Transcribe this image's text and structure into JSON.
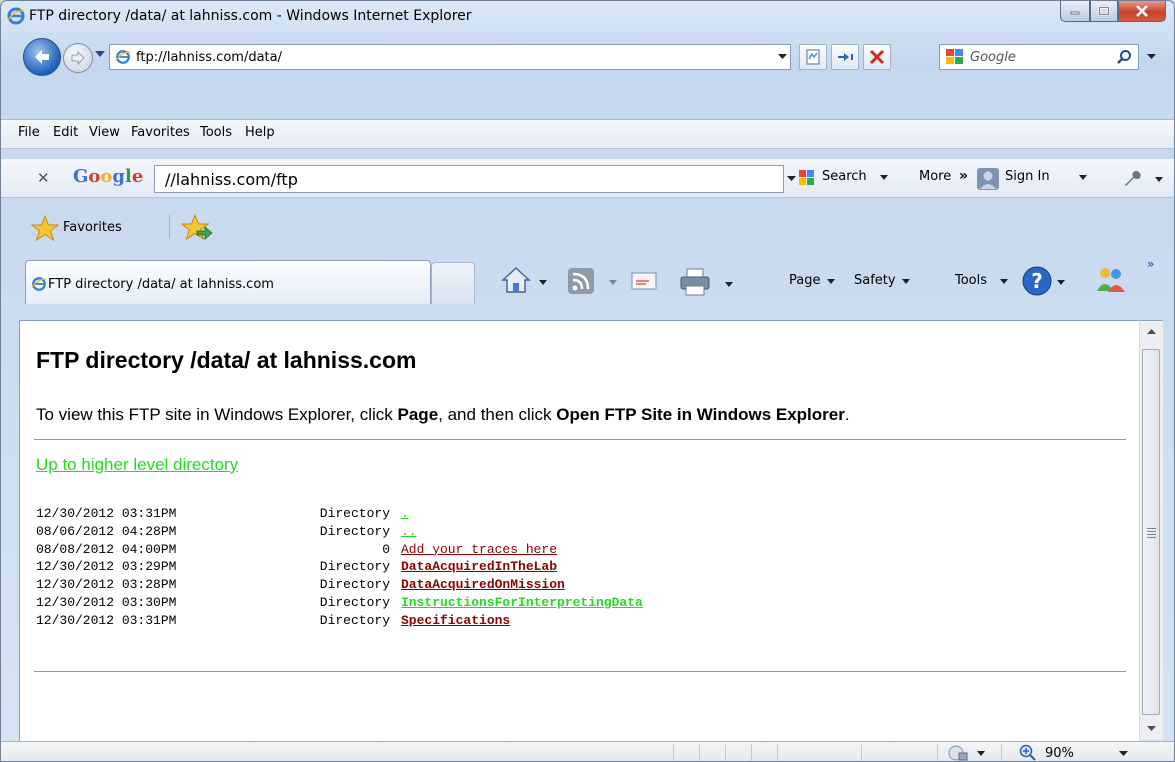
{
  "window": {
    "title": "FTP directory /data/ at lahniss.com - Windows Internet Explorer"
  },
  "address_bar": {
    "url": "ftp://lahniss.com/data/"
  },
  "search_box": {
    "placeholder": "Google"
  },
  "menu": {
    "items": [
      "File",
      "Edit",
      "View",
      "Favorites",
      "Tools",
      "Help"
    ]
  },
  "google_toolbar": {
    "logo": "Google",
    "query": "//lahniss.com/ftp",
    "search_label": "Search",
    "more_label": "More",
    "more_arrows": "»",
    "signin_label": "Sign In"
  },
  "favorites_bar": {
    "label": "Favorites"
  },
  "tab": {
    "title": "FTP directory /data/ at lahniss.com"
  },
  "command_bar": {
    "page": "Page",
    "safety": "Safety",
    "tools": "Tools",
    "chevron": "»"
  },
  "page": {
    "heading": "FTP directory /data/ at lahniss.com",
    "info_prefix": "To view this FTP site in Windows Explorer, click ",
    "info_page": "Page",
    "info_middle": ", and then click ",
    "info_action": "Open FTP Site in Windows Explorer",
    "info_suffix": ".",
    "up_link": "Up to higher level directory",
    "entries": [
      {
        "date": "12/30/2012 03:31PM",
        "kind": "Directory",
        "name": ".",
        "color": "#1fde1f",
        "bold": false
      },
      {
        "date": "08/06/2012 04:28PM",
        "kind": "Directory",
        "name": "..",
        "color": "#1fde1f",
        "bold": false
      },
      {
        "date": "08/08/2012 04:00PM",
        "kind": "0",
        "name": "Add your traces here",
        "color": "#8b0000",
        "bold": false
      },
      {
        "date": "12/30/2012 03:29PM",
        "kind": "Directory",
        "name": "DataAcquiredInTheLab",
        "color": "#8b0000",
        "bold": true
      },
      {
        "date": "12/30/2012 03:28PM",
        "kind": "Directory",
        "name": "DataAcquiredOnMission",
        "color": "#8b0000",
        "bold": true
      },
      {
        "date": "12/30/2012 03:30PM",
        "kind": "Directory",
        "name": "InstructionsForInterpretingData",
        "color": "#1fde1f",
        "bold": true
      },
      {
        "date": "12/30/2012 03:31PM",
        "kind": "Directory",
        "name": "Specifications",
        "color": "#8b0000",
        "bold": true
      }
    ]
  },
  "status_bar": {
    "zoom": "90%"
  }
}
